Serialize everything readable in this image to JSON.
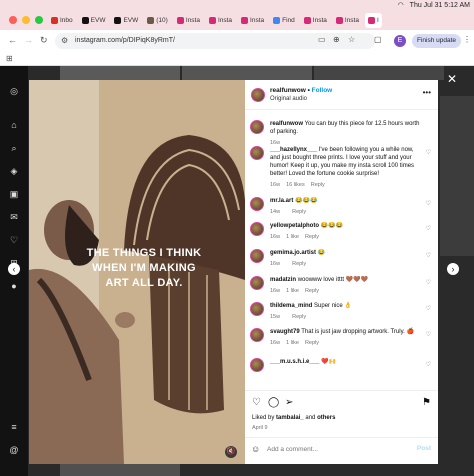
{
  "system": {
    "time": "Thu Jul 31  5:12 AM"
  },
  "tabs": [
    {
      "label": "Inbo",
      "color": "#d93025"
    },
    {
      "label": "EVW",
      "color": "#111111"
    },
    {
      "label": "EVW",
      "color": "#111111"
    },
    {
      "label": "(10)",
      "color": "#6b5b45"
    },
    {
      "label": "Insta",
      "color": "#d62976"
    },
    {
      "label": "Insta",
      "color": "#d62976"
    },
    {
      "label": "Insta",
      "color": "#d62976"
    },
    {
      "label": "Find",
      "color": "#4285f4"
    },
    {
      "label": "Insta",
      "color": "#d62976"
    },
    {
      "label": "Insta",
      "color": "#d62976"
    },
    {
      "label": "I",
      "color": "#d62976",
      "active": true
    }
  ],
  "browser": {
    "url": "instagram.com/p/DIPiqK8yRmT/",
    "profile_initial": "E",
    "finish_update": "Finish update"
  },
  "post": {
    "username": "realfunwow",
    "follow": "Follow",
    "audio": "Original audio",
    "overlay_text": "THE THINGS I THINK WHEN I'M MAKING ART ALL DAY.",
    "caption": {
      "username": "realfunwow",
      "text": "You can buy this piece for 12.5 hours worth of parking.",
      "time": "16w"
    },
    "comments": [
      {
        "user": "___hazellynx___",
        "text": "I've been following you a while now, and just bought three prints. I love your stuff and your humor! Keep it up, you make my insta scroll 100 times better! Loved the fortune cookie surprise!",
        "time": "16w",
        "likes": "16 likes",
        "reply": "Reply"
      },
      {
        "user": "mr.la.art",
        "text": "😂😂😂",
        "time": "14w",
        "likes": "",
        "reply": "Reply"
      },
      {
        "user": "yellowpetalphoto",
        "text": "😂😂😂",
        "time": "16w",
        "likes": "1 like",
        "reply": "Reply"
      },
      {
        "user": "gemima.jo.artist",
        "text": "😂",
        "time": "16w",
        "likes": "",
        "reply": "Reply"
      },
      {
        "user": "madatzin",
        "text": "woowww love itttt 🤎🤎🤎",
        "time": "16w",
        "likes": "1 like",
        "reply": "Reply"
      },
      {
        "user": "thildema_mind",
        "text": "Super nice 👌",
        "time": "15w",
        "likes": "",
        "reply": "Reply"
      },
      {
        "user": "svaught79",
        "text": "That is just jaw dropping artwork. Truly. 🍎",
        "time": "16w",
        "likes": "1 like",
        "reply": "Reply"
      },
      {
        "user": "___m.u.s.h.i.e___",
        "text": "❤️🙌",
        "time": "",
        "likes": "",
        "reply": ""
      }
    ],
    "liked_by_prefix": "Liked by ",
    "liked_by_user": "tambalai_",
    "liked_by_and": " and ",
    "liked_by_others": "others",
    "date": "April 9",
    "add_comment_placeholder": "Add a comment...",
    "post_label": "Post"
  }
}
